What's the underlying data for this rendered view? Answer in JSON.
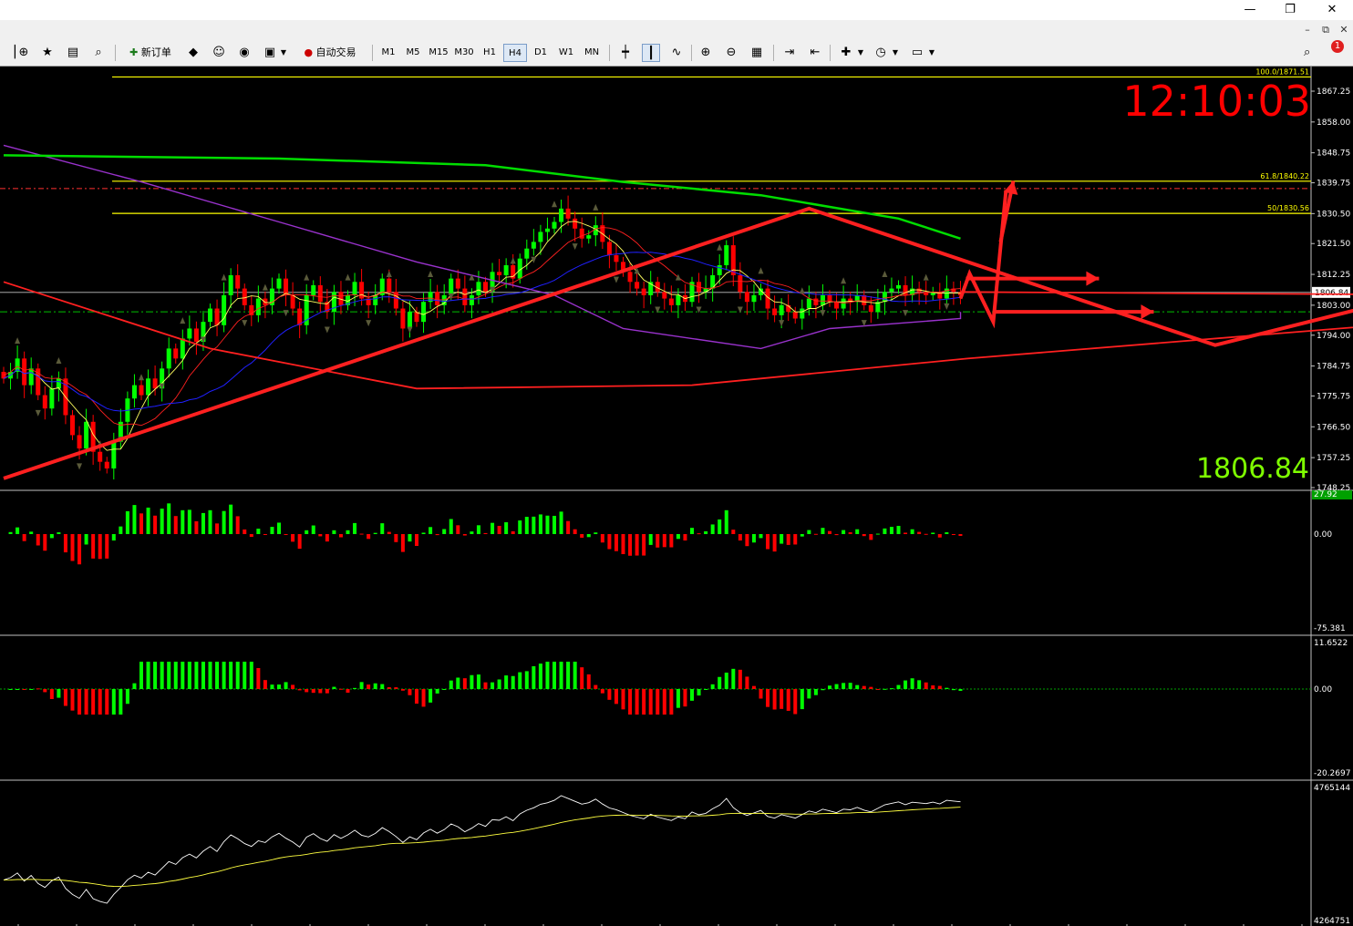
{
  "window": {
    "minimize_glyph": "—",
    "restore_glyph": "❐",
    "close_glyph": "✕",
    "mdi_restore_glyph": "⧉",
    "mdi_close_glyph": "✕",
    "mdi_min_glyph": "–"
  },
  "toolbar": {
    "new_order_label": "新订单",
    "auto_trade_label": "自动交易",
    "timeframes": [
      "M1",
      "M5",
      "M15",
      "M30",
      "H1",
      "H4",
      "D1",
      "W1",
      "MN"
    ],
    "active_timeframe": "H4",
    "notification_badge": "1"
  },
  "clock": "12:10:03",
  "bid_display": "1806.84",
  "colors": {
    "up_candle": "#00ff00",
    "down_candle": "#ff0000",
    "fib_lines": "#ffff00",
    "ma_green": "#00dd00",
    "ma_purple": "#9932cc",
    "ma_red": "#ff2020",
    "ma_blue": "#2020ff",
    "ma_yellow": "#ffff60",
    "arrows": "#ff2020",
    "axis_text": "#ffffff"
  },
  "chart_data": [
    {
      "type": "candlestick",
      "price_axis": [
        "1867.25",
        "1858.00",
        "1848.75",
        "1839.75",
        "1830.50",
        "1821.50",
        "1812.25",
        "1803.00",
        "1794.00",
        "1784.75",
        "1775.75",
        "1766.50",
        "1757.25",
        "1748.25"
      ],
      "ylim": [
        1748.25,
        1873.0
      ],
      "current_price": "1806.84",
      "fib_levels": [
        {
          "label": "100.0/1871.51",
          "value": 1871.51
        },
        {
          "label": "61.8/1840.22",
          "value": 1840.22
        },
        {
          "label": "50/1830.56",
          "value": 1830.56
        }
      ],
      "red_dashed_level": 1838.0,
      "green_dashdot_level": 1801.0,
      "zigzag": [
        [
          0,
          1751
        ],
        [
          117,
          1832
        ],
        [
          176,
          1791
        ],
        [
          207,
          1807
        ]
      ],
      "candles_close": [
        1781,
        1783,
        1787,
        1779,
        1784,
        1776,
        1772,
        1778,
        1781,
        1770,
        1764,
        1760,
        1768,
        1759,
        1756,
        1754,
        1762,
        1768,
        1775,
        1779,
        1776,
        1781,
        1778,
        1784,
        1790,
        1787,
        1793,
        1796,
        1792,
        1798,
        1802,
        1797,
        1806,
        1812,
        1808,
        1803,
        1800,
        1805,
        1803,
        1808,
        1811,
        1806,
        1802,
        1797,
        1806,
        1809,
        1804,
        1801,
        1807,
        1803,
        1806,
        1810,
        1805,
        1803,
        1806,
        1811,
        1807,
        1802,
        1796,
        1801,
        1798,
        1804,
        1807,
        1803,
        1806,
        1811,
        1808,
        1803,
        1806,
        1810,
        1807,
        1813,
        1812,
        1815,
        1811,
        1817,
        1820,
        1822,
        1825,
        1826,
        1828,
        1832,
        1829,
        1826,
        1823,
        1824,
        1827,
        1822,
        1818,
        1816,
        1813,
        1810,
        1808,
        1806,
        1810,
        1807,
        1805,
        1803,
        1806,
        1804,
        1810,
        1807,
        1808,
        1812,
        1815,
        1821,
        1812,
        1807,
        1804,
        1806,
        1808,
        1802,
        1800,
        1803,
        1801,
        1799,
        1802,
        1805,
        1803,
        1806,
        1804,
        1802,
        1805,
        1804,
        1806,
        1803,
        1801,
        1804,
        1807,
        1808,
        1809,
        1806,
        1808,
        1807,
        1806,
        1807,
        1805,
        1808,
        1807,
        1806
      ],
      "indicators": [
        {
          "name": "MACD",
          "axis_top": "27.92",
          "axis_zero": "0.00",
          "axis_bottom": "-75.381"
        },
        {
          "name": "OsMA",
          "axis_top": "11.6522",
          "axis_zero": "0.00",
          "axis_bottom": "-20.2697"
        },
        {
          "name": "Volume-based line",
          "axis_top": "4765144",
          "axis_bottom": "4264751"
        }
      ]
    }
  ]
}
